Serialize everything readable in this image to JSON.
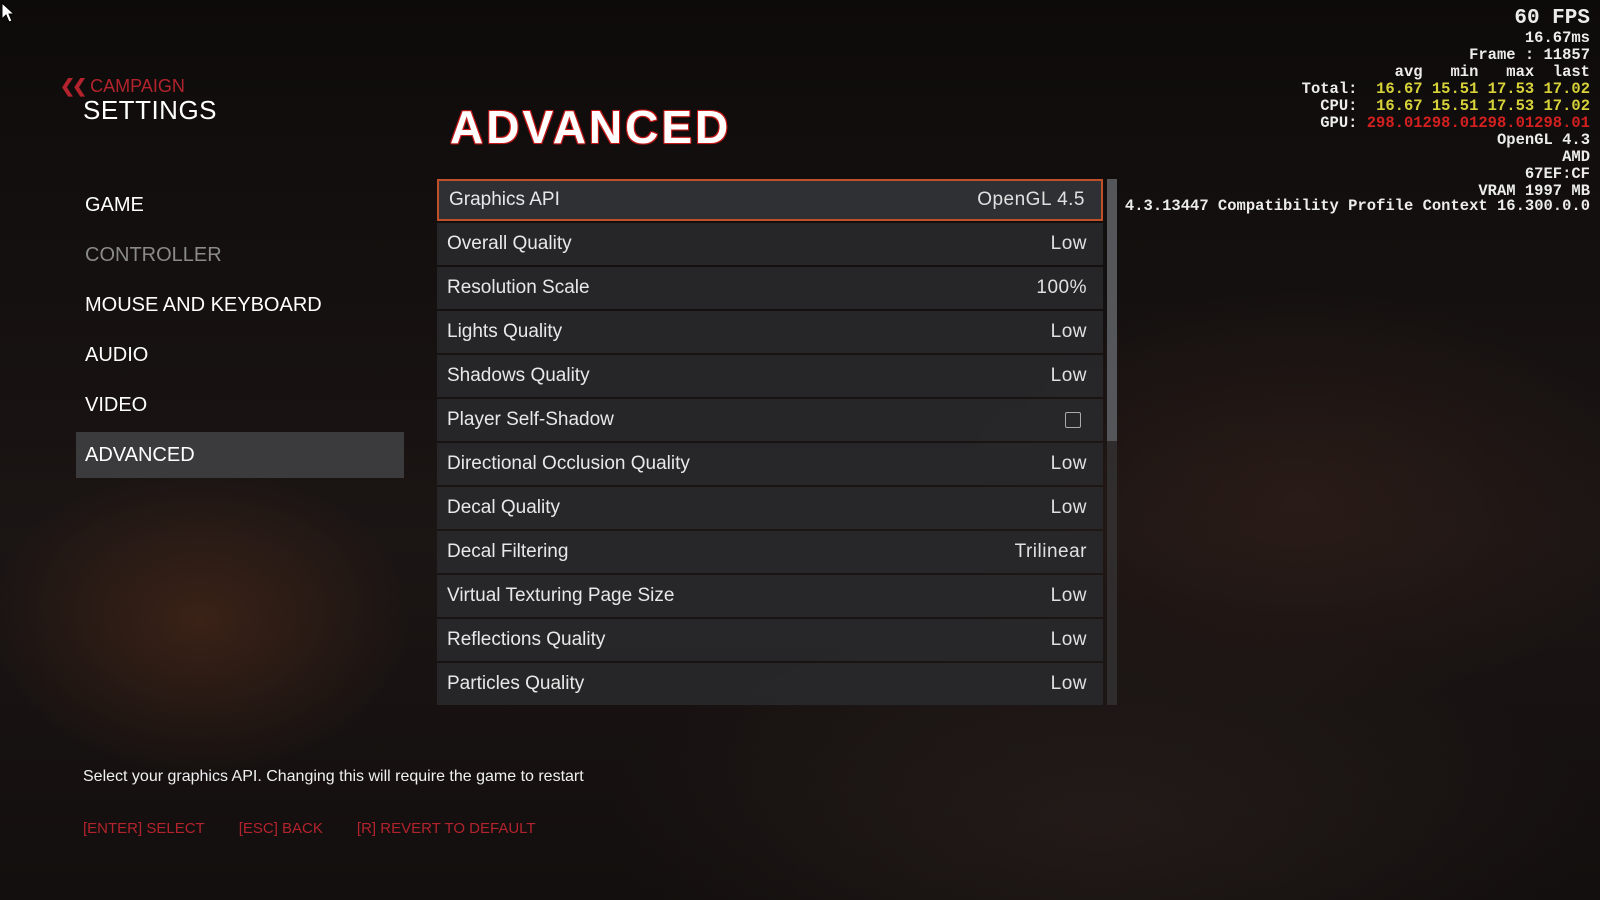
{
  "header": {
    "back_label": "CAMPAIGN",
    "title": "SETTINGS"
  },
  "nav": {
    "items": [
      {
        "label": "GAME"
      },
      {
        "label": "CONTROLLER"
      },
      {
        "label": "MOUSE AND KEYBOARD"
      },
      {
        "label": "AUDIO"
      },
      {
        "label": "VIDEO"
      },
      {
        "label": "ADVANCED"
      }
    ],
    "active": "ADVANCED"
  },
  "page_title": "ADVANCED",
  "settings": [
    {
      "label": "Graphics API",
      "value": "OpenGL 4.5"
    },
    {
      "label": "Overall Quality",
      "value": "Low"
    },
    {
      "label": "Resolution Scale",
      "value": "100%"
    },
    {
      "label": "Lights Quality",
      "value": "Low"
    },
    {
      "label": "Shadows Quality",
      "value": "Low"
    },
    {
      "label": "Player Self-Shadow",
      "checked": false
    },
    {
      "label": "Directional Occlusion Quality",
      "value": "Low"
    },
    {
      "label": "Decal Quality",
      "value": "Low"
    },
    {
      "label": "Decal Filtering",
      "value": "Trilinear"
    },
    {
      "label": "Virtual Texturing Page Size",
      "value": "Low"
    },
    {
      "label": "Reflections Quality",
      "value": "Low"
    },
    {
      "label": "Particles Quality",
      "value": "Low"
    }
  ],
  "description": "Select your graphics API. Changing this will require the game to restart",
  "footer": {
    "select": "[ENTER] SELECT",
    "back": "[ESC] BACK",
    "revert": "[R] REVERT TO DEFAULT"
  },
  "overlay": {
    "fps": "60 FPS",
    "frametime": "16.67ms",
    "frame": "Frame : 11857",
    "cols": "avg   min   max  last",
    "total_label": "Total:",
    "total": "16.67 15.51 17.53 17.02",
    "cpu_label": "CPU:",
    "cpu": "16.67 15.51 17.53 17.02",
    "gpu_label": "GPU:",
    "gpu": "298.01298.01298.01298.01",
    "api": "OpenGL 4.3",
    "vendor": "AMD",
    "device": "67EF:CF",
    "vram": "VRAM 1997 MB",
    "context": "4.3.13447 Compatibility Profile Context 16.300.0.0"
  },
  "colors": {
    "accent": "#b3232d",
    "selected_border": "#c0502a",
    "stat_yellow": "#d8d23a",
    "stat_red": "#d42020"
  }
}
